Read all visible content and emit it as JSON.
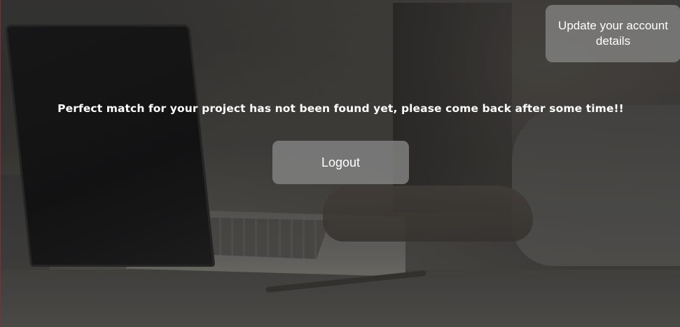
{
  "header": {
    "update_account_label": "Update your account details"
  },
  "main": {
    "message": "Perfect match for your project has not been found yet, please come back after some time!!",
    "logout_label": "Logout"
  },
  "colors": {
    "button_bg": "#848484",
    "text": "#ffffff",
    "page_bg": "#2a2a29"
  }
}
